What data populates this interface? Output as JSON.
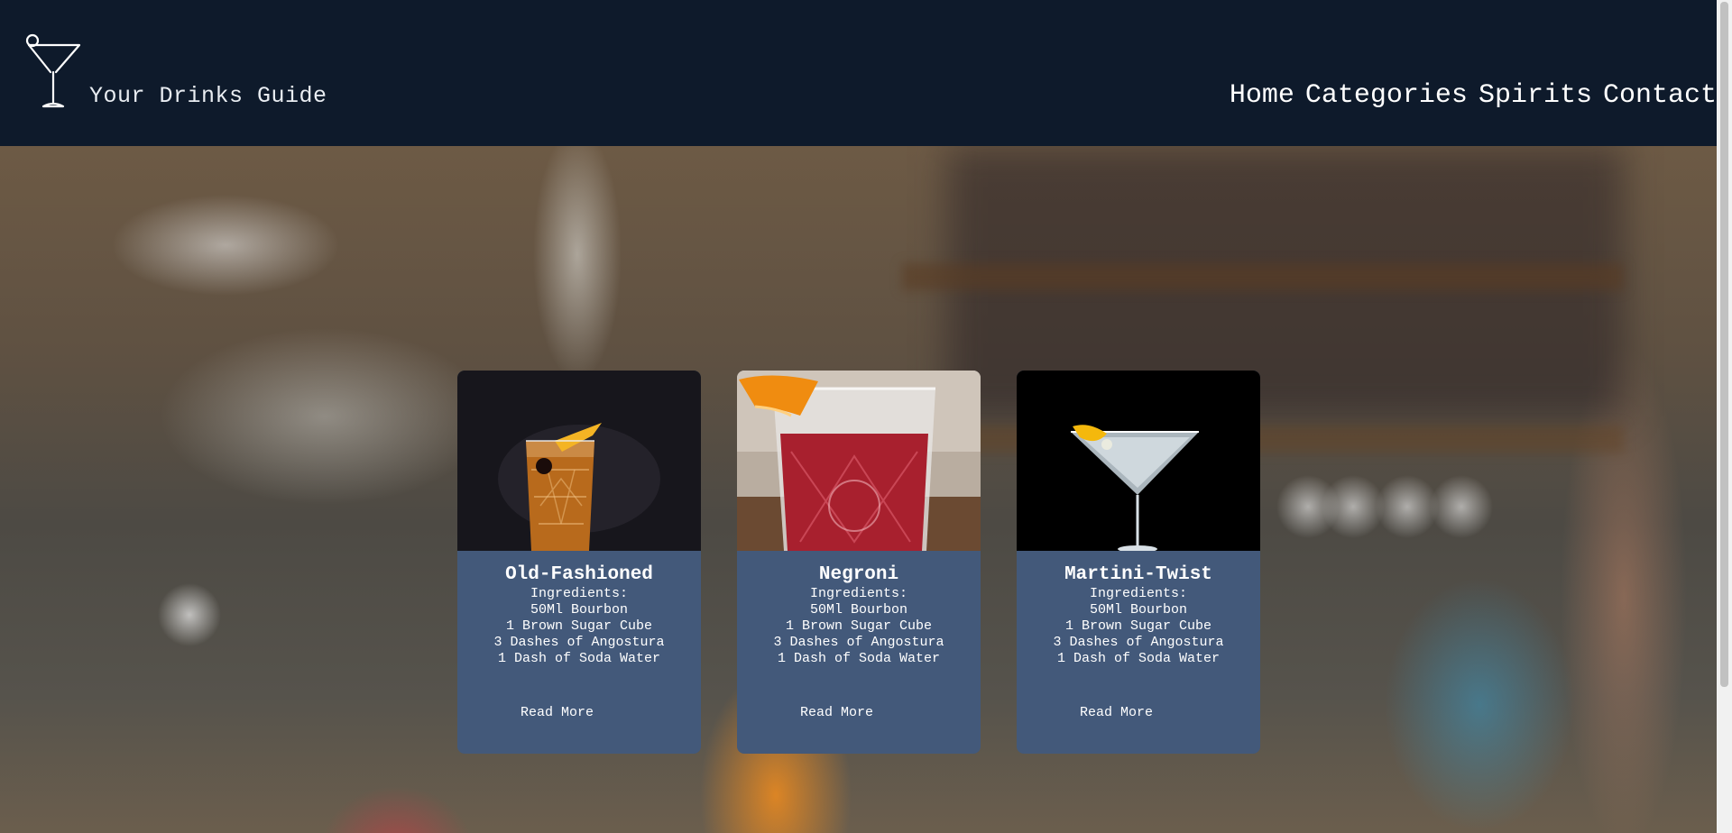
{
  "header": {
    "brand": "Your Drinks Guide",
    "logo_icon": "martini-glass-icon",
    "nav": [
      "Home",
      "Categories",
      "Spirits",
      "Contact"
    ]
  },
  "colors": {
    "header_bg": "#0e1a2b",
    "card_bg": "#43597a",
    "text": "#ffffff"
  },
  "cards": [
    {
      "title": "Old-Fashioned",
      "image": "old-fashioned-cocktail-photo",
      "ingredients_label": "Ingredients:",
      "ingredients": [
        "50Ml Bourbon",
        "1 Brown Sugar Cube",
        "3 Dashes of Angostura",
        "1 Dash of Soda Water"
      ],
      "cta": "Read More"
    },
    {
      "title": "Negroni",
      "image": "negroni-cocktail-photo",
      "ingredients_label": "Ingredients:",
      "ingredients": [
        "50Ml Bourbon",
        "1 Brown Sugar Cube",
        "3 Dashes of Angostura",
        "1 Dash of Soda Water"
      ],
      "cta": "Read More"
    },
    {
      "title": "Martini-Twist",
      "image": "martini-twist-cocktail-photo",
      "ingredients_label": "Ingredients:",
      "ingredients": [
        "50Ml Bourbon",
        "1 Brown Sugar Cube",
        "3 Dashes of Angostura",
        "1 Dash of Soda Water"
      ],
      "cta": "Read More"
    }
  ]
}
